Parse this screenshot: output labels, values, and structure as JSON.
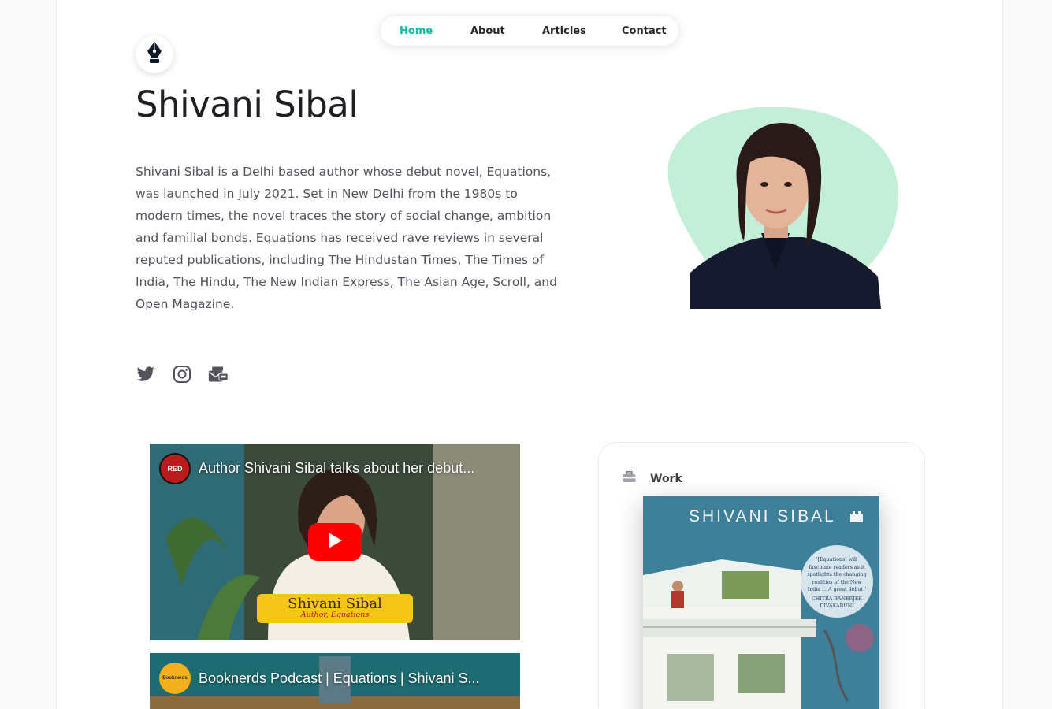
{
  "nav": {
    "items": [
      {
        "label": "Home",
        "active": true
      },
      {
        "label": "About",
        "active": false
      },
      {
        "label": "Articles",
        "active": false
      },
      {
        "label": "Contact",
        "active": false
      }
    ]
  },
  "logo": {
    "icon": "fountain-pen-nib-icon"
  },
  "hero": {
    "title": "Shivani Sibal",
    "bio": "Shivani Sibal is a Delhi based author whose debut novel, Equations, was launched in July 2021. Set in New Delhi from the 1980s to modern times, the novel traces the story of social change, ambition and familial bonds. Equations has received rave reviews in several reputed publications, including The Hindustan Times, The Times of India, The Hindu, The New Indian Express, The Asian Age, Scroll, and Open Magazine."
  },
  "socials": [
    {
      "icon": "twitter-icon"
    },
    {
      "icon": "instagram-icon"
    },
    {
      "icon": "mail-icon"
    }
  ],
  "videos": [
    {
      "title": "Author Shivani Sibal talks about her debut...",
      "channel_badge": "RED",
      "lower_third_name": "Shivani Sibal",
      "lower_third_role": "Author, Equations"
    },
    {
      "title": "Booknerds Podcast | Equations | Shivani S...",
      "channel_badge": "Booknerds"
    }
  ],
  "work": {
    "label": "Work",
    "book_author": "SHIVANI SIBAL",
    "book_quote": "'[Equations] will fascinate readers as it spotlights the changing realities of the New India ... A great debut!'",
    "book_quote_author": "CHITRA BANERJEE DIVAKARUNI"
  },
  "colors": {
    "accent": "#14b8a6",
    "blob": "#c3efd8",
    "book_cover": "#3e7f99",
    "youtube_red": "#ff0000"
  }
}
